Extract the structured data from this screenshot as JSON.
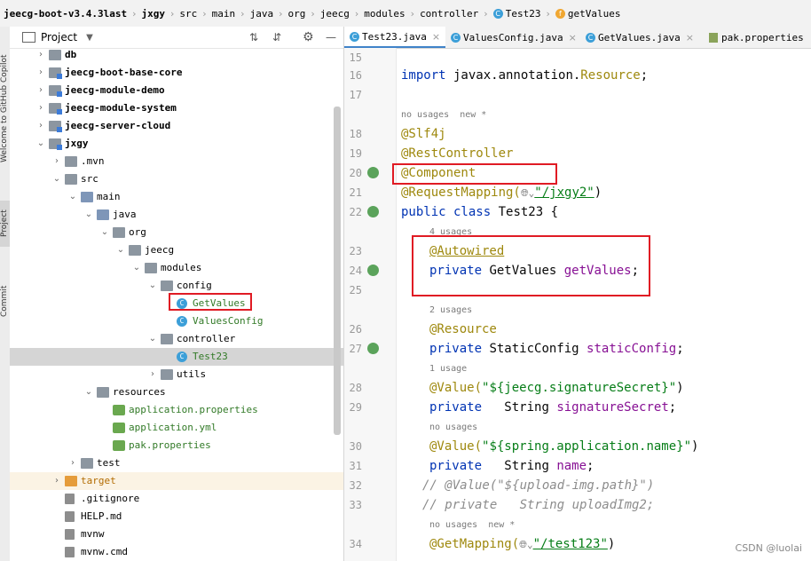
{
  "breadcrumb": [
    "jeecg-boot-v3.4.3last",
    "jxgy",
    "src",
    "main",
    "java",
    "org",
    "jeecg",
    "modules",
    "controller",
    "Test23",
    "getValues"
  ],
  "sidebar_stripe": {
    "top_label": "Welcome to GitHub Copilot",
    "project_label": "Project",
    "commit_label": "Commit"
  },
  "project_panel": {
    "title": "Project"
  },
  "tree": [
    {
      "label": "db",
      "level": 1
    },
    {
      "label": "jeecg-boot-base-core",
      "level": 1
    },
    {
      "label": "jeecg-module-demo",
      "level": 1
    },
    {
      "label": "jeecg-module-system",
      "level": 1
    },
    {
      "label": "jeecg-server-cloud",
      "level": 1
    },
    {
      "label": "jxgy",
      "level": 1
    },
    {
      "label": ".mvn",
      "level": 2
    },
    {
      "label": "src",
      "level": 2
    },
    {
      "label": "main",
      "level": 3
    },
    {
      "label": "java",
      "level": 4
    },
    {
      "label": "org",
      "level": 5
    },
    {
      "label": "jeecg",
      "level": 6
    },
    {
      "label": "modules",
      "level": 7
    },
    {
      "label": "config",
      "level": 8
    },
    {
      "label": "GetValues",
      "level": 9
    },
    {
      "label": "ValuesConfig",
      "level": 9
    },
    {
      "label": "controller",
      "level": 8
    },
    {
      "label": "Test23",
      "level": 9
    },
    {
      "label": "utils",
      "level": 8
    },
    {
      "label": "resources",
      "level": 4
    },
    {
      "label": "application.properties",
      "level": 5
    },
    {
      "label": "application.yml",
      "level": 5
    },
    {
      "label": "pak.properties",
      "level": 5
    },
    {
      "label": "test",
      "level": 3
    },
    {
      "label": "target",
      "level": 2
    },
    {
      "label": ".gitignore",
      "level": 2
    },
    {
      "label": "HELP.md",
      "level": 2
    },
    {
      "label": "mvnw",
      "level": 2
    },
    {
      "label": "mvnw.cmd",
      "level": 2
    }
  ],
  "tabs": [
    "Test23.java",
    "ValuesConfig.java",
    "GetValues.java",
    "pak.properties"
  ],
  "line_numbers": [
    "15",
    "16",
    "17",
    "18",
    "19",
    "20",
    "21",
    "22",
    "23",
    "24",
    "25",
    "26",
    "27",
    "28",
    "29",
    "30",
    "31",
    "32",
    "33",
    "34"
  ],
  "code": {
    "l16_import": "import",
    "l16_pkg": " javax.annotation.",
    "l16_res": "Resource",
    "l16_end": ";",
    "hint_18": "no usages  new *",
    "l18": "@Slf4j",
    "l19": "@RestController",
    "l20": "@Component",
    "l21_ann": "@RequestMapping(",
    "l21_str": "\"/jxgy2\"",
    "l21_end": ")",
    "l22_kw": "public class",
    "l22_rest": " Test23 {",
    "hint_23": "4 usages",
    "l23": "@Autowired",
    "l24_kw": "private",
    "l24_type": " GetValues ",
    "l24_fld": "getValues",
    "l24_end": ";",
    "hint_26": "2 usages",
    "l26": "@Resource",
    "l27_kw": "private",
    "l27_type": " StaticConfig ",
    "l27_fld": "staticConfig",
    "l27_end": ";",
    "hint_28": "1 usage",
    "l28_ann": "@Value(",
    "l28_str": "\"${jeecg.signatureSecret}\"",
    "l28_end": ")",
    "l29_kw": "private",
    "l29_type": "   String ",
    "l29_fld": "signatureSecret",
    "l29_end": ";",
    "hint_30": "no usages",
    "l30_ann": "@Value(",
    "l30_str": "\"${spring.application.name}\"",
    "l30_end": ")",
    "l31_kw": "private",
    "l31_type": "   String ",
    "l31_fld": "name",
    "l31_end": ";",
    "l32": "// @Value(\"${upload-img.path}\")",
    "l33": "// private   String uploadImg2;",
    "hint_34": "no usages  new *",
    "l34_ann": "@GetMapping(",
    "l34_str": "\"/test123\"",
    "l34_end": ")"
  },
  "watermark": "CSDN @luolai",
  "colors": {
    "annotation": "#9e880d",
    "keyword": "#0033b3",
    "string": "#067d17",
    "field": "#871094",
    "highlight_box": "#e01b24"
  }
}
